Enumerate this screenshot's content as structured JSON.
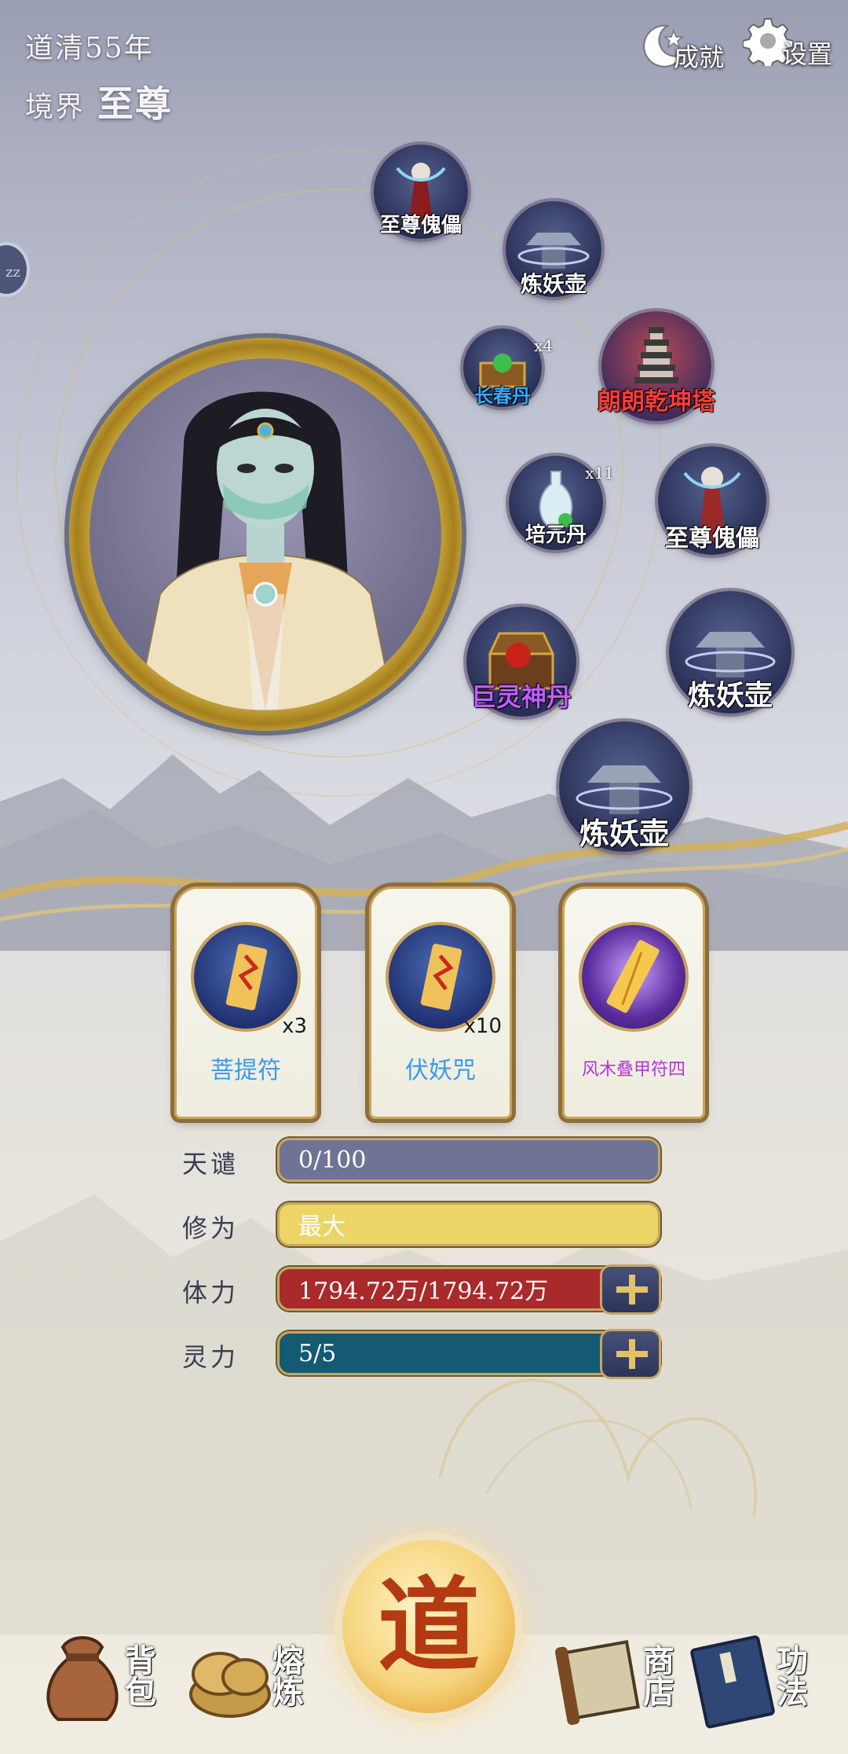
{
  "header": {
    "daoqing": "道清55年",
    "realm_label": "境界",
    "realm_value": "至尊",
    "achievements_label": "成就",
    "settings_label": "设置"
  },
  "items": [
    {
      "name": "至尊傀儡",
      "count": "",
      "color": "#ffffff"
    },
    {
      "name": "炼妖壶",
      "count": "",
      "color": "#ffffff"
    },
    {
      "name": "长春丹",
      "count": "x4",
      "color": "#33aaff"
    },
    {
      "name": "朗朗乾坤塔",
      "count": "",
      "color": "#ff3a3a"
    },
    {
      "name": "培元丹",
      "count": "x11",
      "color": "#ffffff"
    },
    {
      "name": "至尊傀儡",
      "count": "",
      "color": "#ffffff"
    },
    {
      "name": "巨灵神丹",
      "count": "",
      "color": "#c05cff"
    },
    {
      "name": "炼妖壶",
      "count": "",
      "color": "#ffffff"
    },
    {
      "name": "炼妖壶",
      "count": "",
      "color": "#ffffff"
    }
  ],
  "cards": [
    {
      "name": "菩提符",
      "count": "x3",
      "color": "#3b9be8"
    },
    {
      "name": "伏妖咒",
      "count": "x10",
      "color": "#3b9be8"
    },
    {
      "name": "风木叠甲符四",
      "count": "",
      "color": "#b534d6"
    }
  ],
  "stats": [
    {
      "label": "天谴",
      "value": "0/100",
      "color": "#6f7396"
    },
    {
      "label": "修为",
      "value": "最大",
      "color": "#ecd467"
    },
    {
      "label": "体力",
      "value": "1794.72万/1794.72万",
      "color": "#a92a2a"
    },
    {
      "label": "灵力",
      "value": "5/5",
      "color": "#145a73"
    }
  ],
  "nav": {
    "bag": "背包",
    "smelt": "熔炼",
    "dao": "道",
    "shop": "商店",
    "skills": "功法"
  },
  "side_tab_label": "zz"
}
